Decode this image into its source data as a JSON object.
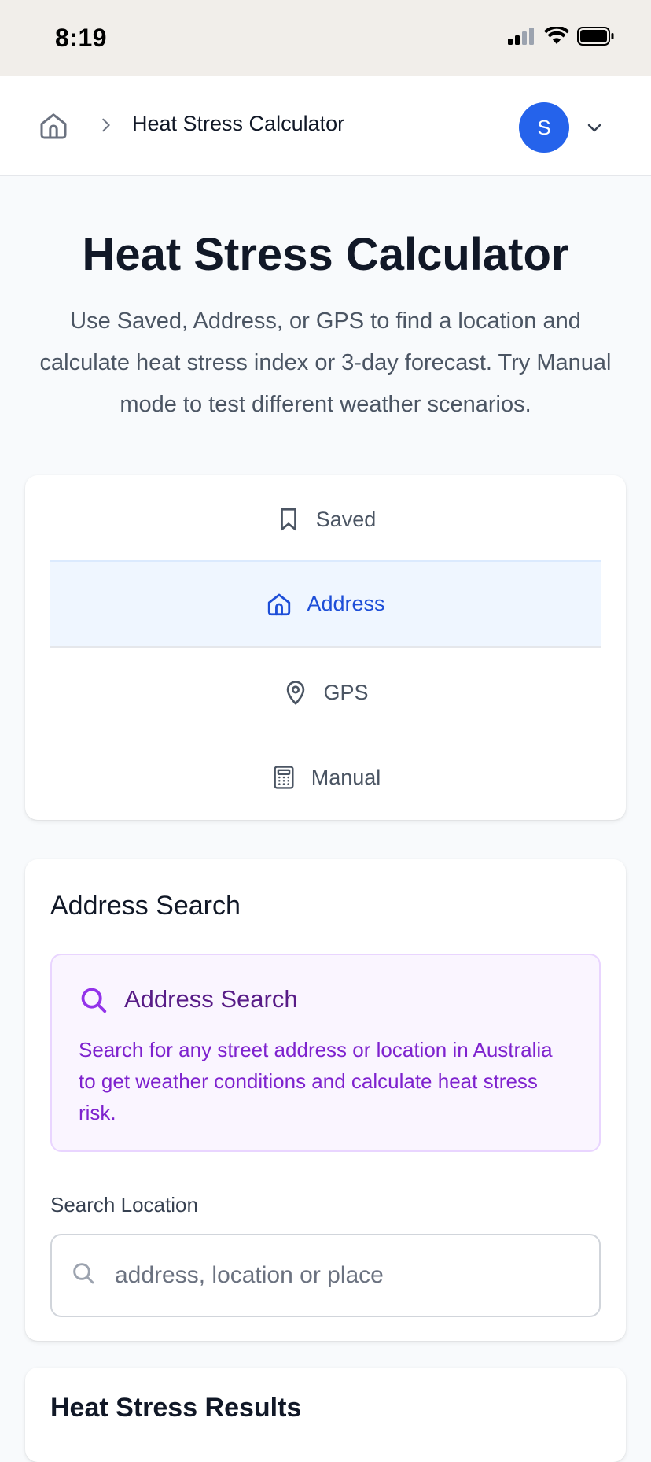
{
  "status_bar": {
    "time": "8:19"
  },
  "header": {
    "breadcrumb_title": "Heat Stress Calculator",
    "avatar_initial": "S"
  },
  "page": {
    "title": "Heat Stress Calculator",
    "description": "Use Saved, Address, or GPS to find a location and calculate heat stress index or 3-day forecast. Try Manual mode to test different weather scenarios."
  },
  "modes": {
    "selected": "Address",
    "items": [
      {
        "label": "Saved",
        "icon": "bookmark-icon"
      },
      {
        "label": "Address",
        "icon": "home-icon"
      },
      {
        "label": "GPS",
        "icon": "map-pin-icon"
      },
      {
        "label": "Manual",
        "icon": "calculator-icon"
      }
    ]
  },
  "address_search": {
    "heading": "Address Search",
    "info_title": "Address Search",
    "info_text": "Search for any street address or location in Australia to get weather conditions and calculate heat stress risk.",
    "field_label": "Search Location",
    "input_placeholder": "address, location or place",
    "input_value": ""
  },
  "results": {
    "heading": "Heat Stress Results"
  },
  "colors": {
    "accent": "#2563eb",
    "active_tab_bg": "#eff6ff",
    "info_bg": "#faf5ff",
    "info_text": "#7e22ce"
  }
}
